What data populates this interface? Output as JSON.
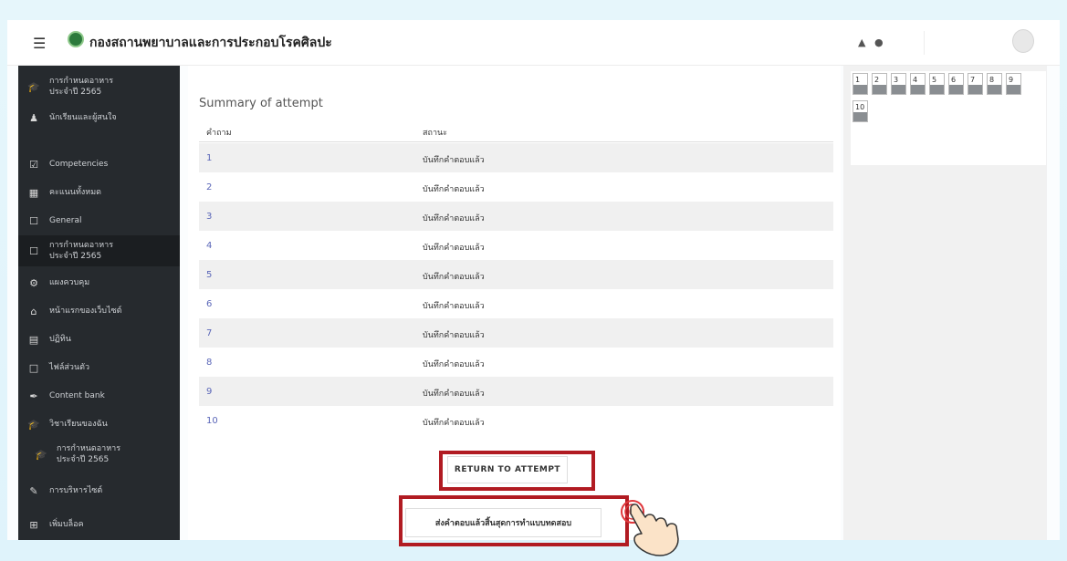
{
  "header": {
    "site_title": "กองสถานพยาบาลและการประกอบโรคศิลปะ",
    "menu_icon": "hamburger-icon",
    "notification_icon": "bell-icon",
    "messages_icon": "chat-icon",
    "avatar_icon": "user-avatar-icon"
  },
  "sidebar": {
    "items": [
      {
        "label": "การกำหนดอาหาร ประจำปี 2565",
        "icon": "graduation-cap-icon"
      },
      {
        "label": "นักเรียนและผู้สนใจ",
        "icon": "users-icon"
      },
      {
        "label": "Competencies",
        "icon": "checkbox-icon"
      },
      {
        "label": "คะแนนทั้งหมด",
        "icon": "table-icon"
      },
      {
        "label": "General",
        "icon": "folder-icon"
      },
      {
        "label": "การกำหนดอาหาร ประจำปี 2565",
        "icon": "folder-icon",
        "active": true
      },
      {
        "label": "แผงควบคุม",
        "icon": "dashboard-icon"
      },
      {
        "label": "หน้าแรกของเว็บไซต์",
        "icon": "home-icon"
      },
      {
        "label": "ปฏิทิน",
        "icon": "calendar-icon"
      },
      {
        "label": "ไฟล์ส่วนตัว",
        "icon": "file-icon"
      },
      {
        "label": "Content bank",
        "icon": "paint-brush-icon"
      },
      {
        "label": "วิชาเรียนของฉัน",
        "icon": "graduation-cap-icon"
      },
      {
        "label": "การกำหนดอาหาร ประจำปี 2565",
        "icon": "graduation-cap-icon",
        "sub": true
      },
      {
        "label": "การบริหารไซต์",
        "icon": "wrench-icon"
      },
      {
        "label": "เพิ่มบล็อค",
        "icon": "plus-square-icon"
      }
    ]
  },
  "main": {
    "summary_title": "Summary of attempt",
    "table": {
      "headers": [
        "คำถาม",
        "สถานะ"
      ],
      "rows": [
        {
          "q": "1",
          "status": "บันทึกคำตอบแล้ว"
        },
        {
          "q": "2",
          "status": "บันทึกคำตอบแล้ว"
        },
        {
          "q": "3",
          "status": "บันทึกคำตอบแล้ว"
        },
        {
          "q": "4",
          "status": "บันทึกคำตอบแล้ว"
        },
        {
          "q": "5",
          "status": "บันทึกคำตอบแล้ว"
        },
        {
          "q": "6",
          "status": "บันทึกคำตอบแล้ว"
        },
        {
          "q": "7",
          "status": "บันทึกคำตอบแล้ว"
        },
        {
          "q": "8",
          "status": "บันทึกคำตอบแล้ว"
        },
        {
          "q": "9",
          "status": "บันทึกคำตอบแล้ว"
        },
        {
          "q": "10",
          "status": "บันทึกคำตอบแล้ว"
        }
      ]
    },
    "return_button": "RETURN TO ATTEMPT",
    "submit_button": "ส่งคำตอบแล้วสิ้นสุดการทำแบบทดสอบ"
  },
  "quiz_navigation": {
    "questions": [
      "1",
      "2",
      "3",
      "4",
      "5",
      "6",
      "7",
      "8",
      "9",
      "10"
    ]
  },
  "colors": {
    "sidebar_bg": "#262a2e",
    "highlight_border": "#b11b22",
    "link_blue": "#5a66b8",
    "answered_bar": "#8a8e92"
  }
}
